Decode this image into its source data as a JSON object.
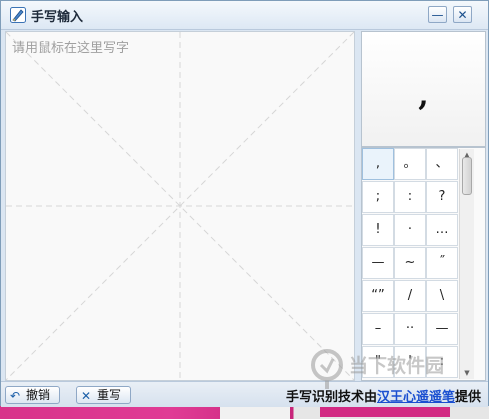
{
  "window": {
    "title": "手写输入",
    "minimize_label": "—",
    "close_label": "✕"
  },
  "canvas": {
    "placeholder": "请用鼠标在这里写字"
  },
  "candidate": {
    "char": ","
  },
  "symbols": [
    ",",
    "。",
    "、",
    ";",
    ":",
    "?",
    "!",
    "·",
    "…",
    "—",
    "~",
    "˝",
    "“”",
    "/",
    "\\",
    "–",
    "··",
    "—",
    "\"",
    "'",
    ":"
  ],
  "selected_symbol_index": 0,
  "toolbar": {
    "undo_label": "撤销",
    "undo_icon": "↶",
    "rewrite_label": "重写",
    "rewrite_icon": "✕",
    "credit_prefix": "手写识别技术由",
    "credit_link": "汉王",
    "credit_link2": "心遥遥笔",
    "credit_suffix": "提供"
  },
  "watermark": {
    "text": "当下软件园"
  },
  "colors": {
    "accent": "#1a4fd0",
    "title_bg": "#dde8f4",
    "banner": "#d8338a"
  }
}
